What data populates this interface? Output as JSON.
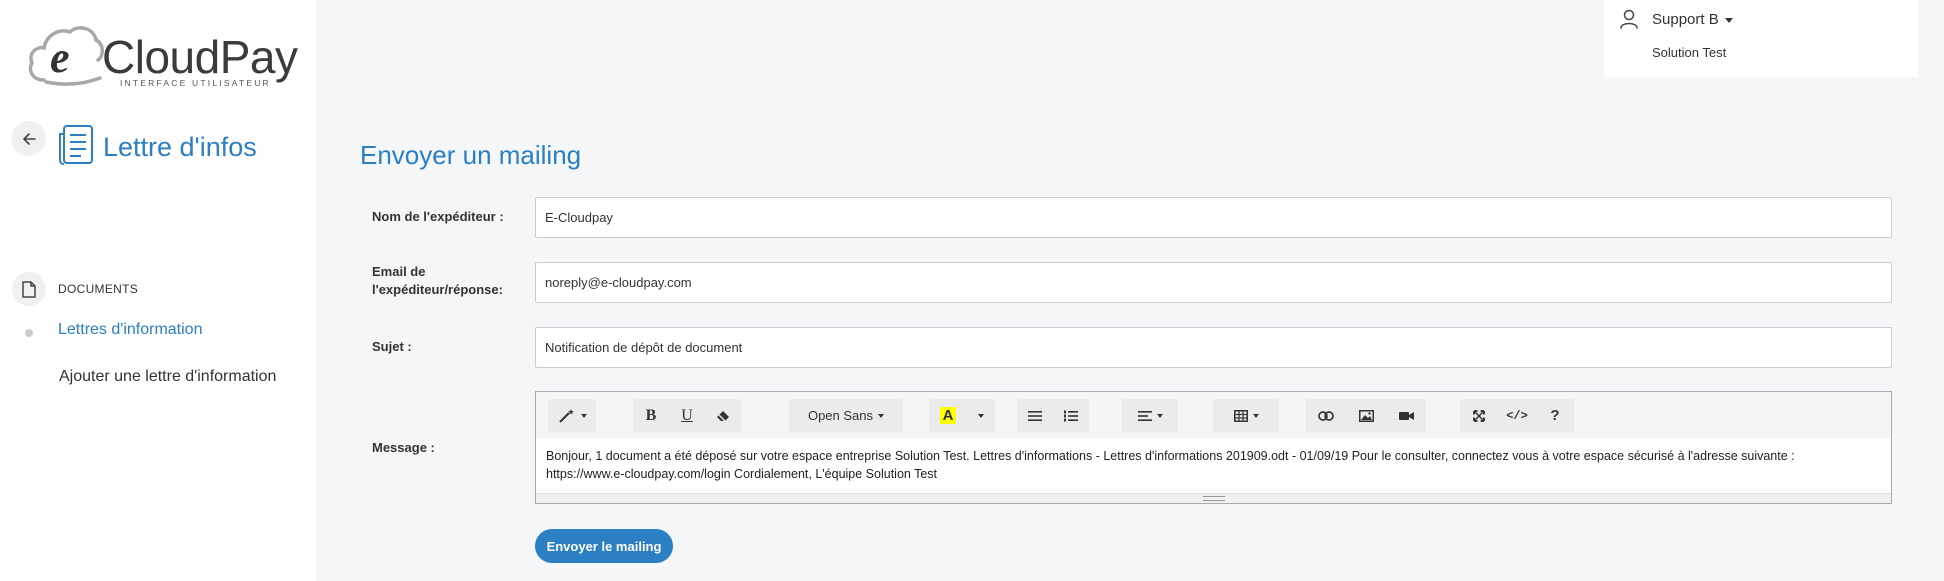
{
  "brand": {
    "logo_word": "CloudPay",
    "logo_tagline": "INTERFACE UTILISATEUR",
    "accent_color": "#2b7fc3"
  },
  "sidebar": {
    "page_title": "Lettre d'infos",
    "section_label": "DOCUMENTS",
    "items": [
      {
        "label": "Lettres d'information",
        "active": true
      },
      {
        "label": "Ajouter une lettre d'information",
        "active": false
      }
    ]
  },
  "user": {
    "name": "Support B",
    "company": "Solution Test"
  },
  "form": {
    "heading": "Envoyer un mailing",
    "sender_name_label": "Nom de l'expéditeur :",
    "sender_name_value": "E-Cloudpay",
    "sender_email_label_line1": "Email de",
    "sender_email_label_line2": "l'expéditeur/réponse:",
    "sender_email_value": "noreply@e-cloudpay.com",
    "subject_label": "Sujet :",
    "subject_value": "Notification de dépôt de document",
    "message_label": "Message :",
    "message_value": "Bonjour, 1 document a été déposé sur votre espace entreprise Solution Test. Lettres d'informations - Lettres d'informations 201909.odt - 01/09/19 Pour le consulter, connectez vous à votre espace sécurisé à l'adresse suivante : https://www.e-cloudpay.com/login Cordialement, L'équipe Solution Test",
    "send_button": "Envoyer le mailing"
  },
  "editor_toolbar": {
    "font_name": "Open Sans",
    "bold": "B",
    "underline": "U",
    "highlight": "A",
    "code": "</>",
    "help": "?"
  }
}
